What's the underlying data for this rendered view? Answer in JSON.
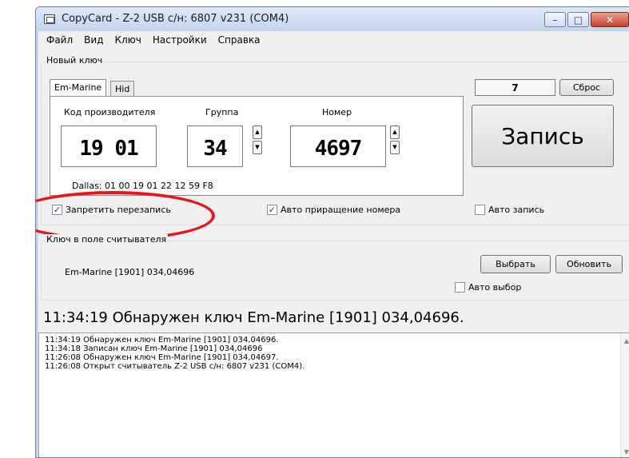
{
  "window": {
    "title": "CopyCard - Z-2 USB с/н: 6807 v231 (COM4)",
    "buttons": {
      "minimize": "–",
      "maximize": "□",
      "close": "✕"
    }
  },
  "menu": [
    {
      "label": "Файл"
    },
    {
      "label": "Вид"
    },
    {
      "label": "Ключ"
    },
    {
      "label": "Настройки"
    },
    {
      "label": "Справка"
    }
  ],
  "new_key": {
    "group_label": "Новый ключ",
    "tabs": [
      {
        "label": "Em-Marine",
        "active": true
      },
      {
        "label": "Hid",
        "active": false
      }
    ],
    "labels": {
      "manufacturer": "Код производителя",
      "group": "Группа",
      "number": "Номер"
    },
    "values": {
      "manufacturer": "19 01",
      "group": "34",
      "number": "4697"
    },
    "dallas": "Dallas:  01 00 19 01 22 12 59 F8",
    "counter": "7",
    "reset_button": "Сброс",
    "write_button": "Запись",
    "checkboxes": [
      {
        "label": "Запретить перезапись",
        "checked": true
      },
      {
        "label": "Авто приращение номера",
        "checked": true
      },
      {
        "label": "Авто запись",
        "checked": false
      }
    ]
  },
  "reader": {
    "group_label": "Ключ в поле считывателя",
    "key_text": "Em-Marine [1901] 034,04696",
    "select_button": "Выбрать",
    "refresh_button": "Обновить",
    "auto_select": {
      "label": "Авто выбор",
      "checked": false
    }
  },
  "status_line": "11:34:19  Обнаружен ключ Em-Marine [1901] 034,04696.",
  "log": [
    "11:34:19  Обнаружен ключ Em-Marine [1901] 034,04696.",
    "11:34:18  Записан ключ Em-Marine [1901] 034,04696",
    "11:26:08  Обнаружен ключ Em-Marine [1901] 034,04697.",
    "11:26:08  Открыт считыватель Z-2 USB с/н: 6807 v231 (COM4)."
  ],
  "colors": {
    "highlight": "#e8161b"
  }
}
